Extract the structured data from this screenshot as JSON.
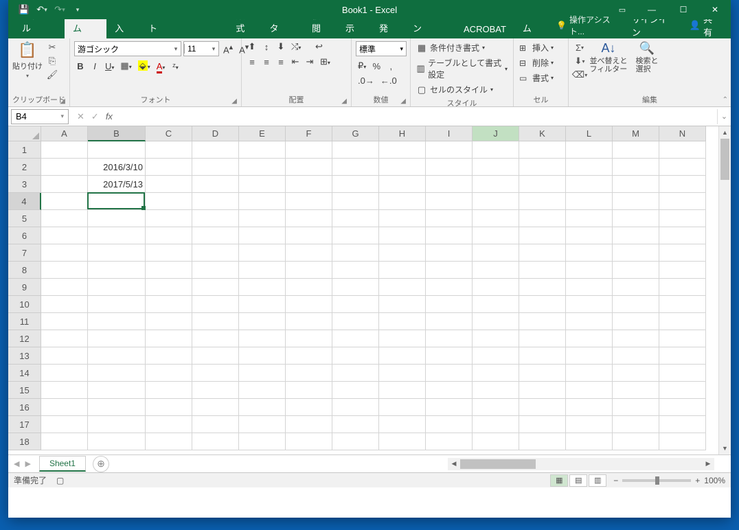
{
  "title": "Book1 - Excel",
  "tabs": {
    "file": "ファイル",
    "home": "ホーム",
    "insert": "挿入",
    "pagelayout": "ページ レイアウト",
    "formulas": "数式",
    "data": "データ",
    "review": "校閲",
    "view": "表示",
    "developer": "開発",
    "addins": "アドイン",
    "acrobat": "ACROBAT",
    "team": "チーム"
  },
  "tell": "操作アシスト...",
  "signin": "サインイン",
  "share": "共有",
  "ribbon": {
    "clipboard": {
      "paste": "貼り付け",
      "label": "クリップボード"
    },
    "font": {
      "name": "游ゴシック",
      "size": "11",
      "label": "フォント"
    },
    "align": {
      "label": "配置"
    },
    "number": {
      "fmt": "標準",
      "label": "数値"
    },
    "styles": {
      "cond": "条件付き書式",
      "table": "テーブルとして書式設定",
      "cell": "セルのスタイル",
      "label": "スタイル"
    },
    "cells": {
      "insert": "挿入",
      "delete": "削除",
      "format": "書式",
      "label": "セル"
    },
    "editing": {
      "sort": "並べ替えと\nフィルター",
      "find": "検索と\n選択",
      "label": "編集"
    }
  },
  "namebox": "B4",
  "columns": [
    "A",
    "B",
    "C",
    "D",
    "E",
    "F",
    "G",
    "H",
    "I",
    "J",
    "K",
    "L",
    "M",
    "N"
  ],
  "highlightCol": "J",
  "selectedCol": "B",
  "selectedRow": 4,
  "rows": [
    1,
    2,
    3,
    4,
    5,
    6,
    7,
    8,
    9,
    10,
    11,
    12,
    13,
    14,
    15,
    16,
    17,
    18
  ],
  "cells": {
    "B2": "2016/3/10",
    "B3": "2017/5/13"
  },
  "sheet": "Sheet1",
  "status": "準備完了",
  "zoom": "100%"
}
